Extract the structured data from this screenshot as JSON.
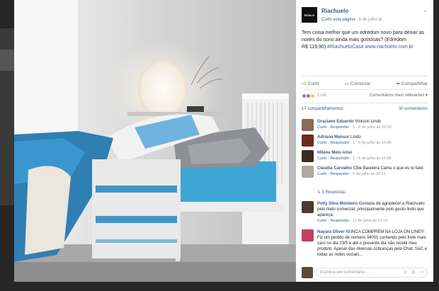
{
  "page": {
    "name": "Riachuelo",
    "follow_label": "Curtir esta página",
    "time": "6 de julho",
    "logo_text": "RCHLO"
  },
  "post": {
    "text": "Tem coisa melhor que um edredom novo para deixar as noites do sono ainda mais gostosas? (Edredom",
    "text2": "R$ 119,90) ",
    "hashtag": "#RiachueloCasa www.riachuelo.com.br"
  },
  "actions": {
    "like": "Curtir",
    "comment": "Comentar",
    "share": "Compartilhar"
  },
  "reactions": {
    "count": "1 mil",
    "sort_label": "Comentários mais relevantes",
    "like_color": "#5890ff",
    "love_color": "#f25268",
    "haha_color": "#fcd046"
  },
  "counts": {
    "shares": "17 compartilhamentos",
    "comments": "30 comentários"
  },
  "comments": [
    {
      "name": "Graciane Eduardo",
      "text": "Vinicius Lindo",
      "meta_actions": "Curtir · Responder",
      "meta_info": "· 1 · 6 de julho às 16:10",
      "avatar_color": "#8a6b55"
    },
    {
      "name": "Adriana Mansur",
      "text": "Lindo",
      "meta_actions": "Curtir · Responder",
      "meta_info": "· 1 · 6 de julho às 16:40",
      "avatar_color": "#6a2a20"
    },
    {
      "name": "Milene Melo",
      "text": "Amei",
      "meta_actions": "Curtir · Responder",
      "meta_info": "· 1 · 6 de julho às 16:58",
      "avatar_color": "#3a2a22"
    },
    {
      "name": "Claudia Carvalho",
      "text": "Cibe Basileira Canta o que eu te falei",
      "meta_actions": "Curtir · Responder",
      "meta_info": "· 6 de julho às 20:51",
      "avatar_color": "#b0a8a0"
    },
    {
      "name": "Polly Silva Monteiro",
      "text": "Gostaria de agradecer a Riachuelo pelo lindo comercial, principalmente pelo gesto lindo que apareça.",
      "meta_actions": "Curtir · Responder",
      "meta_info": "· 11 de julho às 21:19",
      "avatar_color": "#4a3a30"
    },
    {
      "name": "Nayara Oliver",
      "text": "NUNCA COMPREM NA LOJA ON LINE!!! Fiz um pedido de número 34001 contando pelo frete mais caro no dia 23/5 e até o presente dia não recebi meu produto. Apesar das diversas cobranças pelo Chat, SAC e todas as redes sociais...",
      "meta_actions": "",
      "meta_info": "",
      "avatar_color": "#c04060"
    }
  ],
  "replies_label": "5 Respostas",
  "composer": {
    "placeholder": "Escreva um comentário...",
    "icons": "☺ ◎ ▭"
  }
}
